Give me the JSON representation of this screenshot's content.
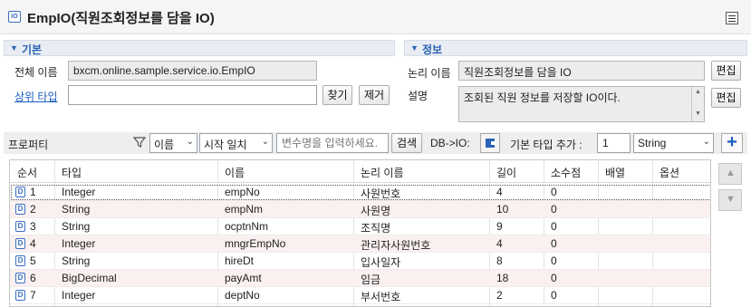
{
  "header": {
    "icon_text": "IO",
    "title": "EmpIO(직원조회정보를 담을 IO)",
    "tool_icon": "table-layout-icon"
  },
  "basic": {
    "section_label": "기본",
    "full_name_label": "전체 이름",
    "full_name_value": "bxcm.online.sample.service.io.EmpIO",
    "parent_type_label": "상위 타입",
    "parent_type_value": "",
    "find_label": "찾기",
    "remove_label": "제거"
  },
  "info": {
    "section_label": "정보",
    "logical_name_label": "논리 이름",
    "logical_name_value": "직원조회정보를 담을 IO",
    "edit_label": "편집",
    "description_label": "설명",
    "description_value": "조회된 직원 정보를 저장할 IO이다.",
    "edit2_label": "편집"
  },
  "properties": {
    "label": "프로퍼티",
    "filter_field": "이름",
    "filter_mode": "시작 일치",
    "search_placeholder": "변수명을 입력하세요.",
    "search_label": "검색",
    "db_io_label": "DB->IO:",
    "add_type_label": "기본 타입 추가 :",
    "add_count": "1",
    "add_type_value": "String",
    "add_label": "+"
  },
  "table": {
    "columns": [
      "순서",
      "타입",
      "이름",
      "논리 이름",
      "길이",
      "소수점",
      "배열",
      "옵션"
    ],
    "rows": [
      {
        "order": "1",
        "type": "Integer",
        "name": "empNo",
        "logical": "사원번호",
        "length": "4",
        "scale": "0",
        "array": "",
        "option": ""
      },
      {
        "order": "2",
        "type": "String",
        "name": "empNm",
        "logical": "사원명",
        "length": "10",
        "scale": "0",
        "array": "",
        "option": ""
      },
      {
        "order": "3",
        "type": "String",
        "name": "ocptnNm",
        "logical": "조직명",
        "length": "9",
        "scale": "0",
        "array": "",
        "option": ""
      },
      {
        "order": "4",
        "type": "Integer",
        "name": "mngrEmpNo",
        "logical": "관리자사원번호",
        "length": "4",
        "scale": "0",
        "array": "",
        "option": ""
      },
      {
        "order": "5",
        "type": "String",
        "name": "hireDt",
        "logical": "입사일자",
        "length": "8",
        "scale": "0",
        "array": "",
        "option": ""
      },
      {
        "order": "6",
        "type": "BigDecimal",
        "name": "payAmt",
        "logical": "임금",
        "length": "18",
        "scale": "0",
        "array": "",
        "option": ""
      },
      {
        "order": "7",
        "type": "Integer",
        "name": "deptNo",
        "logical": "부서번호",
        "length": "2",
        "scale": "0",
        "array": "",
        "option": ""
      }
    ],
    "row_icon_text": "D"
  },
  "side": {
    "up_icon": "▲",
    "down_icon": "▼"
  },
  "colors": {
    "accent": "#2a62b5",
    "alt_row": "#fbf0f0"
  }
}
